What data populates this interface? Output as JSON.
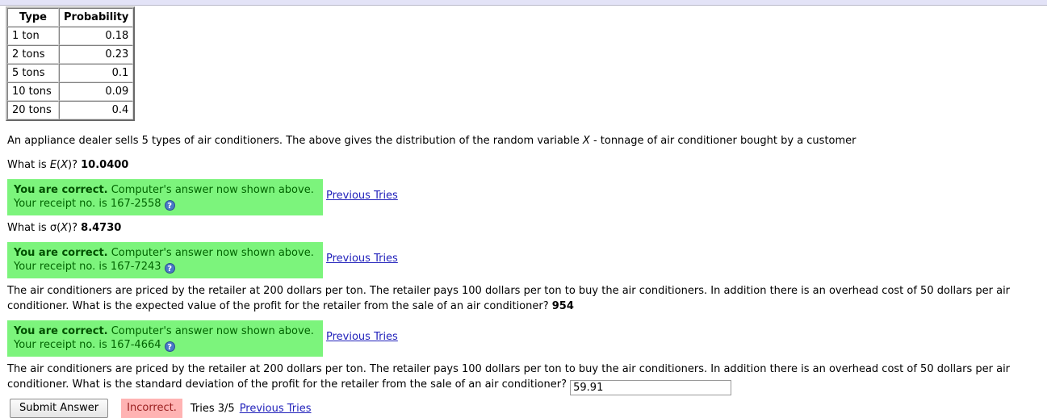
{
  "table": {
    "headers": [
      "Type",
      "Probability"
    ],
    "rows": [
      {
        "type": "1 ton",
        "probability": "0.18"
      },
      {
        "type": "2 tons",
        "probability": "0.23"
      },
      {
        "type": "5 tons",
        "probability": "0.1"
      },
      {
        "type": "10 tons",
        "probability": "0.09"
      },
      {
        "type": "20 tons",
        "probability": "0.4"
      }
    ]
  },
  "intro": {
    "text_before_var": "An appliance dealer sells 5 types of air conditioners. The above gives the distribution of the random variable ",
    "variable": "X",
    "text_after_var": " - tonnage of air conditioner bought by a customer"
  },
  "questions": [
    {
      "prompt_before": "What is ",
      "prompt_symbol": "E",
      "prompt_var": "X",
      "prompt_after": ")? ",
      "answer": "10.0400",
      "feedback": {
        "bold": "You are correct.",
        "rest": " Computer's answer now shown above.",
        "receipt": "Your receipt no. is 167-2558",
        "help_icon": "question-mark-icon",
        "link": "Previous Tries"
      }
    },
    {
      "prompt_before": "What is ",
      "prompt_symbol": "σ",
      "prompt_var": "X",
      "prompt_after": ")? ",
      "answer": "8.4730",
      "feedback": {
        "bold": "You are correct.",
        "rest": " Computer's answer now shown above.",
        "receipt": "Your receipt no. is 167-7243",
        "help_icon": "question-mark-icon",
        "link": "Previous Tries"
      }
    }
  ],
  "profit_expected": {
    "text": "The air conditioners are priced by the retailer at 200 dollars per ton. The retailer pays 100 dollars per ton to buy the air conditioners. In addition there is an overhead cost of 50 dollars per air conditioner. What is the expected value of the profit for the retailer from the sale of an air conditioner? ",
    "answer": "954",
    "feedback": {
      "bold": "You are correct.",
      "rest": " Computer's answer now shown above.",
      "receipt": "Your receipt no. is 167-4664",
      "help_icon": "question-mark-icon",
      "link": "Previous Tries"
    }
  },
  "profit_sd": {
    "text": "The air conditioners are priced by the retailer at 200 dollars per ton. The retailer pays 100 dollars per ton to buy the air conditioners. In addition there is an overhead cost of 50 dollars per air conditioner. What is the standard deviation of the profit for the retailer from the sale of an air conditioner? ",
    "input_value": "59.91",
    "input_placeholder": ""
  },
  "bottom": {
    "submit_label": "Submit Answer",
    "status_label": "Incorrect.",
    "tries_label": "Tries 3/5",
    "prev_tries_label": "Previous Tries"
  },
  "colors": {
    "correct_bg": "#7cf47c",
    "correct_text": "#006400",
    "incorrect_bg": "#ffb3b3",
    "incorrect_text": "#9a2020",
    "link": "#2222bb",
    "top_band": "#e3e3f7"
  }
}
